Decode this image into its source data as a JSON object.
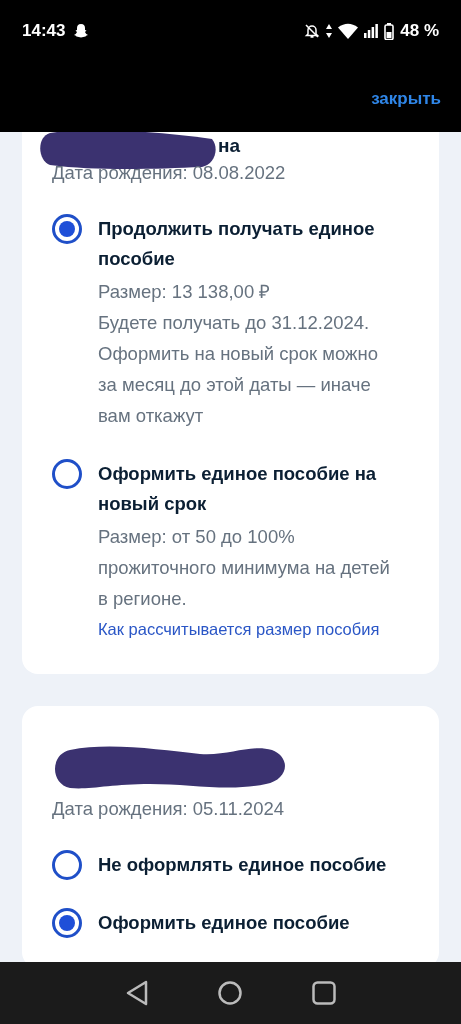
{
  "status_bar": {
    "time": "14:43",
    "battery": "48 %"
  },
  "header": {
    "close_link": "закрыть"
  },
  "children": [
    {
      "redacted": true,
      "name": "на",
      "birth_date": "Дата рождения: 08.08.2022",
      "options": [
        {
          "title": "Продолжить получать единое пособие",
          "selected": true,
          "details": [
            "Размер: 13 138,00 ₽",
            "Будете получать до 31.12.2024. Оформить на новый срок можно за месяц до этой даты — иначе вам откажут"
          ]
        },
        {
          "title": "Оформить единое пособие на новый срок",
          "selected": false,
          "details": [
            "Размер: от 50 до 100% прожиточного минимума на детей в регионе."
          ],
          "link": "Как рассчитывается размер пособия"
        }
      ]
    },
    {
      "redacted": true,
      "birth_date": "Дата рождения: 05.11.2024",
      "options": [
        {
          "title": "Не оформлять единое пособие",
          "selected": false
        },
        {
          "title": "Оформить единое пособие",
          "selected": true
        }
      ]
    }
  ]
}
